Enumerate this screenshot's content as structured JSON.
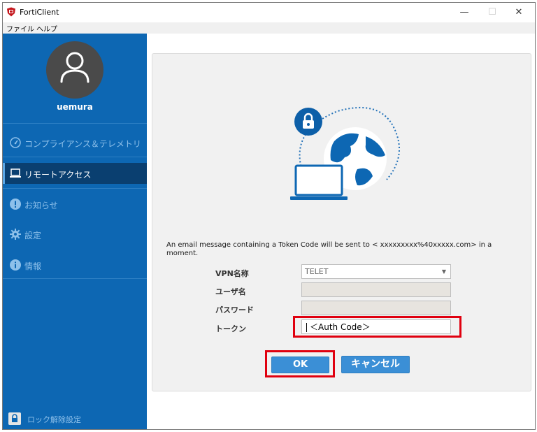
{
  "window": {
    "title": "FortiClient",
    "minimize": "—",
    "maximize": "☐",
    "close": "✕"
  },
  "menubar": [
    "ファイル",
    "ヘルプ"
  ],
  "sidebar": {
    "username": "uemura",
    "items": [
      {
        "label": "コンプライアンス＆テレメトリ",
        "icon": "gauge-icon"
      },
      {
        "label": "リモートアクセス",
        "icon": "laptop-icon",
        "active": true
      },
      {
        "label": "お知らせ",
        "icon": "alert-icon"
      },
      {
        "label": "設定",
        "icon": "gear-icon"
      },
      {
        "label": "情報",
        "icon": "info-icon"
      }
    ],
    "lock_setting": "ロック解除設定"
  },
  "main": {
    "message": "An email message containing a Token Code will be sent to <      xxxxxxxxx%40xxxxx.com> in a moment.",
    "form": {
      "vpn_label": "VPN名称",
      "vpn_value": "TELET",
      "user_label": "ユーザ名",
      "password_label": "パスワード",
      "token_label": "トークン",
      "token_value": "＜Auth Code＞"
    },
    "buttons": {
      "ok": "OK",
      "cancel": "キャンセル"
    }
  },
  "colors": {
    "sidebar": "#0d67b3",
    "active": "#0a3f70",
    "button": "#3b8fd6",
    "highlight": "#e0000f"
  }
}
